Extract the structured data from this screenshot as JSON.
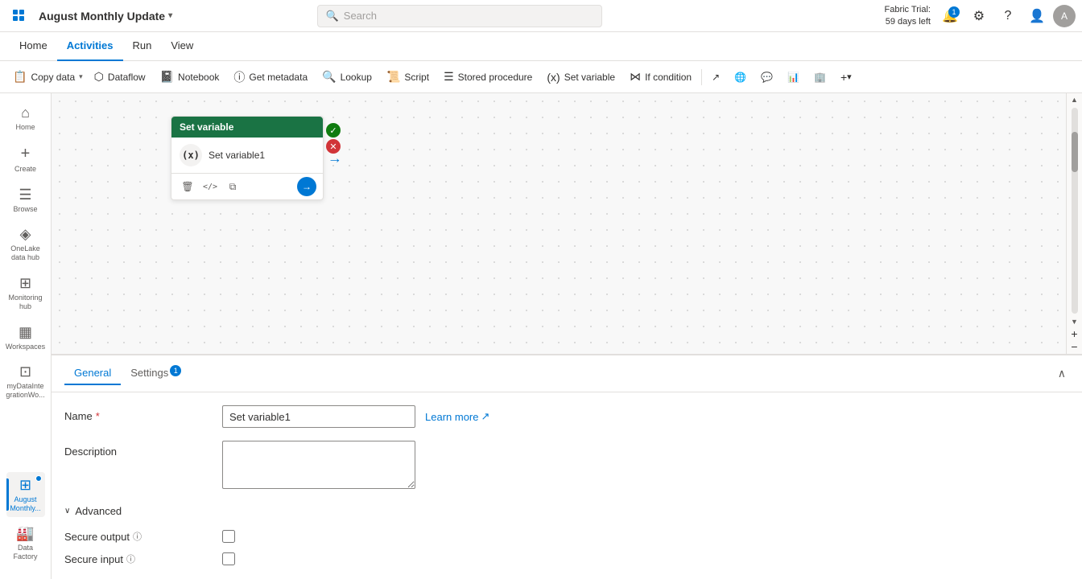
{
  "topbar": {
    "apps_icon": "⊞",
    "app_name": "August Monthly Update",
    "chevron": "▾",
    "search_placeholder": "Search",
    "fabric_trial_line1": "Fabric Trial:",
    "fabric_trial_line2": "59 days left",
    "notification_icon": "🔔",
    "notification_badge": "1",
    "settings_icon": "⚙",
    "help_icon": "?",
    "user_icon": "👤"
  },
  "nav_tabs": [
    {
      "id": "home",
      "label": "Home",
      "active": false
    },
    {
      "id": "activities",
      "label": "Activities",
      "active": true
    },
    {
      "id": "run",
      "label": "Run",
      "active": false
    },
    {
      "id": "view",
      "label": "View",
      "active": false
    }
  ],
  "toolbar": {
    "copy_data": "Copy data",
    "dataflow": "Dataflow",
    "notebook": "Notebook",
    "get_metadata": "Get metadata",
    "lookup": "Lookup",
    "script": "Script",
    "stored_procedure": "Stored procedure",
    "set_variable": "Set variable",
    "if_condition": "If condition",
    "more": "+",
    "more_label": ""
  },
  "sidebar": {
    "items": [
      {
        "id": "home",
        "icon": "⌂",
        "label": "Home"
      },
      {
        "id": "create",
        "icon": "+",
        "label": "Create"
      },
      {
        "id": "browse",
        "icon": "☰",
        "label": "Browse"
      },
      {
        "id": "onelake",
        "icon": "◈",
        "label": "OneLake data hub"
      },
      {
        "id": "monitoring",
        "icon": "⊞",
        "label": "Monitoring hub"
      },
      {
        "id": "workspaces",
        "icon": "▦",
        "label": "Workspaces"
      },
      {
        "id": "mydata",
        "icon": "⊡",
        "label": "myDataInte grationWo..."
      }
    ],
    "bottom": {
      "id": "august-monthly",
      "icon": "⊞",
      "label": "August Monthly...",
      "has_dot": true
    },
    "datafactory": {
      "icon": "🏭",
      "label": "Data Factory"
    }
  },
  "activity_node": {
    "title": "Set variable",
    "icon": "(x)",
    "name": "Set variable1",
    "status_success": "✓",
    "status_error": "✕",
    "toolbar_delete": "🗑",
    "toolbar_code": "</>",
    "toolbar_copy": "⧉",
    "toolbar_arrow": "→"
  },
  "bottom_panel": {
    "tab_general": "General",
    "tab_settings": "Settings",
    "tab_settings_badge": "1",
    "collapse_icon": "∧",
    "name_label": "Name",
    "name_required": "*",
    "name_value": "Set variable1",
    "learn_more": "Learn more",
    "learn_more_icon": "↗",
    "description_label": "Description",
    "description_value": "",
    "advanced_label": "Advanced",
    "advanced_chevron": "∨",
    "secure_output_label": "Secure output",
    "secure_input_label": "Secure input",
    "info_icon": "ⓘ"
  }
}
